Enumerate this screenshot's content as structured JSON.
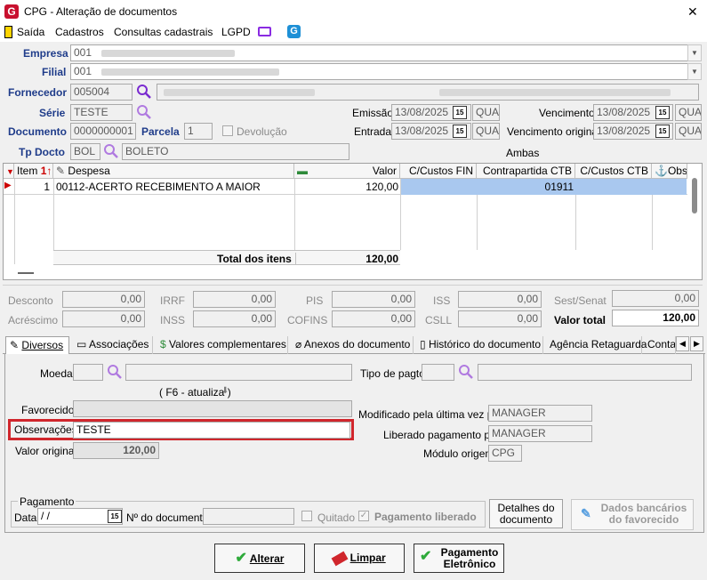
{
  "window": {
    "title": "CPG - Alteração de documentos",
    "close": "✕"
  },
  "menu": {
    "saida": "Saída",
    "cadastros": "Cadastros",
    "consultas": "Consultas cadastrais",
    "lgpd": "LGPD"
  },
  "header": {
    "empresa_label": "Empresa",
    "empresa_code": "001",
    "filial_label": "Filial",
    "filial_code": "001",
    "fornecedor_label": "Fornecedor",
    "fornecedor_code": "005004",
    "serie_label": "Série",
    "serie_value": "TESTE",
    "documento_label": "Documento",
    "documento_value": "0000000001",
    "parcela_label": "Parcela",
    "parcela_value": "1",
    "devolucao_label": "Devolução",
    "tpdocto_label": "Tp Docto",
    "tpdocto_code": "BOL",
    "tpdocto_desc": "BOLETO",
    "emissao_label": "Emissão",
    "emissao_date": "13/08/2025",
    "emissao_day": "QUA",
    "entrada_label": "Entrada",
    "entrada_date": "13/08/2025",
    "entrada_day": "QUA",
    "vencimento_label": "Vencimento",
    "vencimento_date": "13/08/2025",
    "vencimento_day": "QUA",
    "venc_original_label": "Vencimento original",
    "venc_original_date": "13/08/2025",
    "venc_original_day": "QUA",
    "ambas_label": "Ambas",
    "calendar_glyph": "15"
  },
  "grid": {
    "columns": [
      "Item",
      "Despesa",
      "Valor",
      "C/Custos FIN",
      "Contrapartida CTB",
      "C/Custos CTB",
      "Obs"
    ],
    "rows": [
      {
        "item": "1",
        "despesa": "00112-ACERTO RECEBIMENTO A MAIOR",
        "valor": "120,00",
        "contrapartida": "01911"
      }
    ],
    "total_label": "Total dos itens",
    "total_value": "120,00"
  },
  "taxes": {
    "desconto": {
      "label": "Desconto",
      "value": "0,00"
    },
    "acrescimo": {
      "label": "Acréscimo",
      "value": "0,00"
    },
    "irrf": {
      "label": "IRRF",
      "value": "0,00"
    },
    "inss": {
      "label": "INSS",
      "value": "0,00"
    },
    "pis": {
      "label": "PIS",
      "value": "0,00"
    },
    "cofins": {
      "label": "COFINS",
      "value": "0,00"
    },
    "iss": {
      "label": "ISS",
      "value": "0,00"
    },
    "csll": {
      "label": "CSLL",
      "value": "0,00"
    },
    "sest": {
      "label": "Sest/Senat",
      "value": "0,00"
    },
    "valor_total": {
      "label": "Valor total",
      "value": "120,00"
    }
  },
  "tabs": [
    "Diversos",
    "Associações",
    "Valores complementares",
    "Anexos do documento",
    "Histórico do documento",
    "Agência Retaguarda",
    "Contal"
  ],
  "diversos": {
    "moeda_label": "Moeda",
    "tipo_pagto_label": "Tipo de pagto",
    "f6_label": "( F6 - atualiza )",
    "favorecido_label": "Favorecido",
    "observacoes_label": "Observações",
    "observacoes_value": "TESTE",
    "valor_original_label": "Valor original",
    "valor_original_value": "120,00",
    "modificado_label": "Modificado pela última vez por",
    "modificado_value": "MANAGER",
    "liberado_label": "Liberado pagamento por",
    "liberado_value": "MANAGER",
    "modulo_label": "Módulo origem",
    "modulo_value": "CPG"
  },
  "pagamento": {
    "group_label": "Pagamento",
    "data_label": "Data",
    "data_value": " /  /",
    "ndoc_label": "Nº do documento",
    "quitado_label": "Quitado",
    "liberado_label": "Pagamento liberado",
    "detalhes_button": "Detalhes do documento",
    "dados_bancarios_button": "Dados bancários do favorecido"
  },
  "buttons": {
    "alterar": "Alterar",
    "limpar": "Limpar",
    "pagamento_eletronico": "Pagamento Eletrônico"
  },
  "colors": {
    "label_blue": "#1f3c8a",
    "highlight_red": "#d0262c",
    "selected_cell": "#a9c8ef",
    "app_red": "#c8102e"
  }
}
